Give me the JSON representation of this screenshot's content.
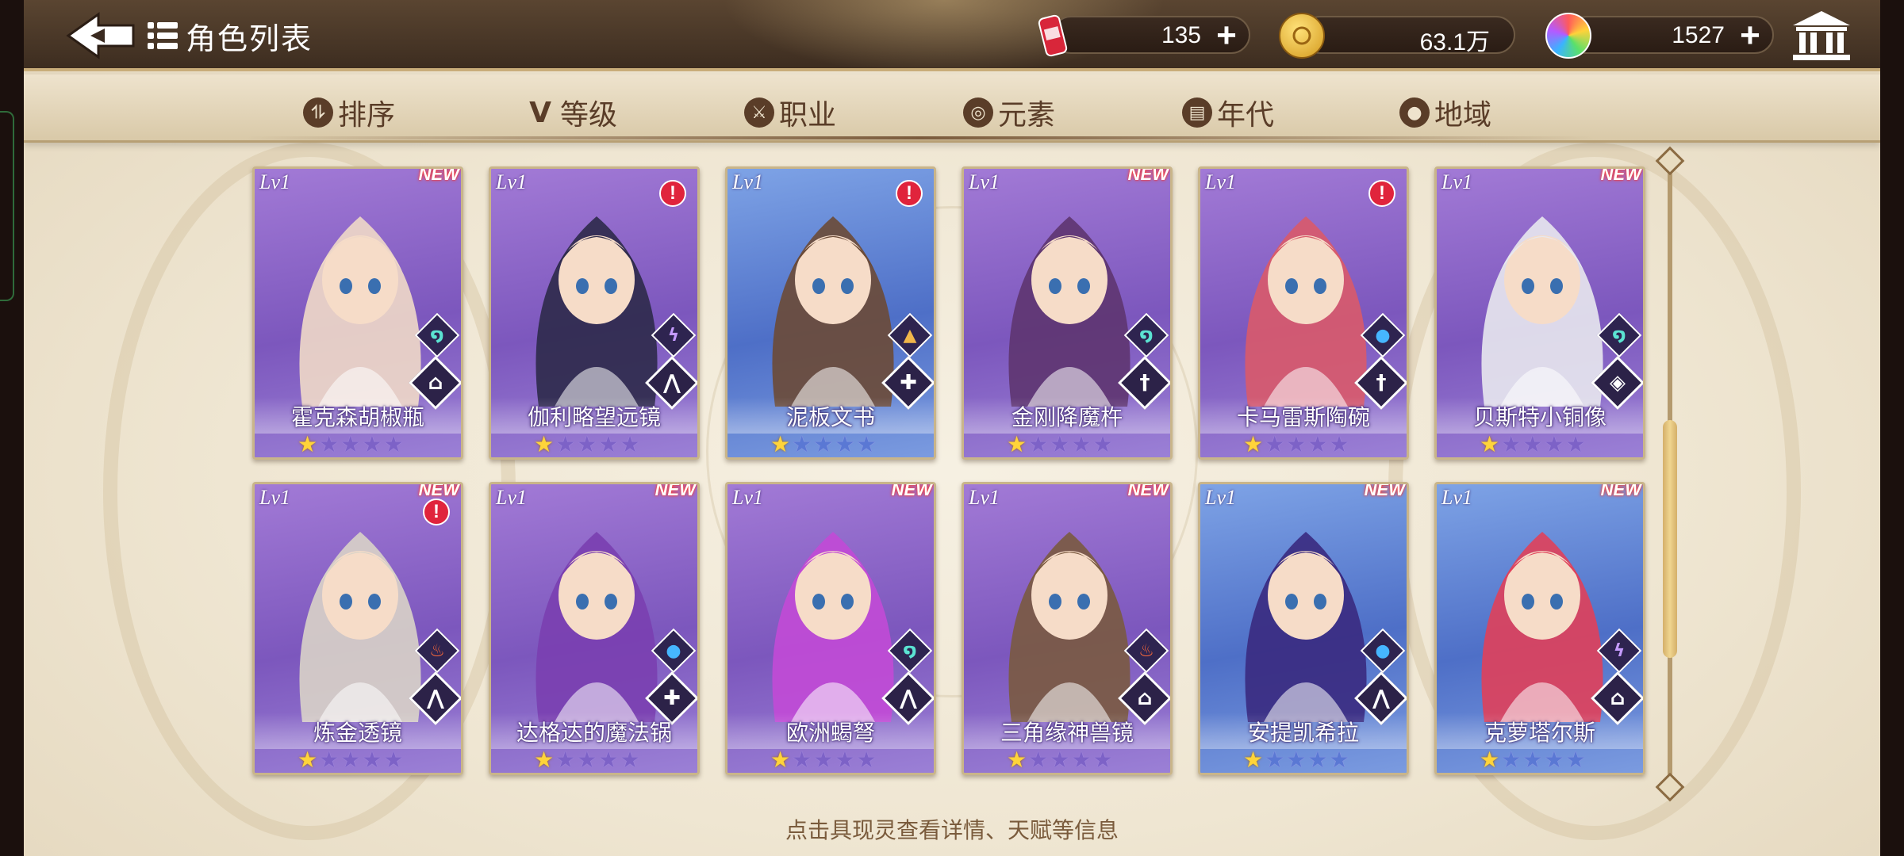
{
  "header": {
    "title": "角色列表",
    "resources": [
      {
        "name": "stamina",
        "icon": "soda-can-icon",
        "value": "135"
      },
      {
        "name": "coins",
        "icon": "gold-coin-icon",
        "value": "63.1万"
      },
      {
        "name": "gems",
        "icon": "rainbow-gem-icon",
        "value": "1527"
      }
    ],
    "plus_symbol": "+"
  },
  "filters": [
    {
      "label": "排序",
      "icon": "sort-icon",
      "glyph": "⥮"
    },
    {
      "label": "等级",
      "icon": "level-icon",
      "glyph": "V"
    },
    {
      "label": "职业",
      "icon": "class-icon",
      "glyph": "⚔"
    },
    {
      "label": "元素",
      "icon": "element-icon",
      "glyph": "◎"
    },
    {
      "label": "年代",
      "icon": "era-icon",
      "glyph": "▤"
    },
    {
      "label": "地域",
      "icon": "region-icon",
      "glyph": "●"
    }
  ],
  "lv_label": "Lv1",
  "new_label": "NEW",
  "alert_label": "!",
  "characters": [
    {
      "name": "霍克森胡椒瓶",
      "rarity": "purple",
      "stars": 1,
      "tag": "new",
      "element": "wind",
      "class": "scholar"
    },
    {
      "name": "伽利略望远镜",
      "rarity": "purple",
      "stars": 1,
      "tag": "alert",
      "element": "thunder",
      "class": "archer"
    },
    {
      "name": "泥板文书",
      "rarity": "blue",
      "stars": 1,
      "tag": "alert",
      "element": "earth",
      "class": "healer"
    },
    {
      "name": "金刚降魔杵",
      "rarity": "purple",
      "stars": 1,
      "tag": "new",
      "element": "wind",
      "class": "warrior"
    },
    {
      "name": "卡马雷斯陶碗",
      "rarity": "purple",
      "stars": 1,
      "tag": "alert",
      "element": "water",
      "class": "warrior"
    },
    {
      "name": "贝斯特小铜像",
      "rarity": "purple",
      "stars": 1,
      "tag": "new",
      "element": "wind",
      "class": "guardian"
    },
    {
      "name": "炼金透镜",
      "rarity": "purple",
      "stars": 1,
      "tag": "new-alert",
      "element": "fire",
      "class": "archer"
    },
    {
      "name": "达格达的魔法锅",
      "rarity": "purple",
      "stars": 1,
      "tag": "new",
      "element": "water",
      "class": "healer"
    },
    {
      "name": "欧洲蝎弩",
      "rarity": "purple",
      "stars": 1,
      "tag": "new",
      "element": "wind",
      "class": "archer"
    },
    {
      "name": "三角缘神兽镜",
      "rarity": "purple",
      "stars": 1,
      "tag": "new",
      "element": "fire",
      "class": "scholar"
    },
    {
      "name": "安提凯希拉",
      "rarity": "blue",
      "stars": 1,
      "tag": "new",
      "element": "water",
      "class": "archer"
    },
    {
      "name": "克萝塔尔斯",
      "rarity": "blue",
      "stars": 1,
      "tag": "new",
      "element": "thunder",
      "class": "scholar"
    }
  ],
  "max_stars": 5,
  "hint": "点击具现灵查看详情、天赋等信息",
  "colors": {
    "topbar": "#4a3828",
    "gold_trim": "#c9ad7a",
    "card_purple": "#8e68cb",
    "card_blue": "#5d7fd3",
    "new_glow": "#ff3b2f",
    "alert_red": "#e0243c",
    "star_on": "#ffd43a"
  }
}
